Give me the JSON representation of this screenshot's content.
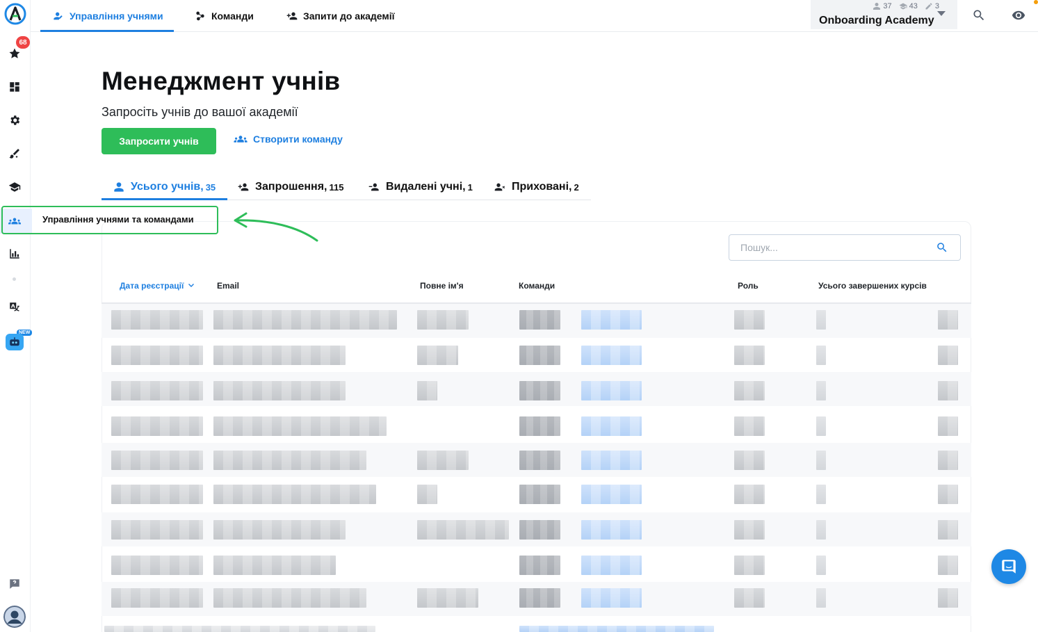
{
  "app": {
    "logo_icon": "academy-logo-icon",
    "accent": "#1e7fe0",
    "success": "#2ebd59",
    "badge_color": "#ef4444"
  },
  "sidebar": {
    "favorites_badge": "68",
    "new_label": "NEW",
    "items": [
      {
        "icon": "star-icon"
      },
      {
        "icon": "dashboard-icon"
      },
      {
        "icon": "gear-icon"
      },
      {
        "icon": "brush-icon"
      },
      {
        "icon": "graduation-cap-icon"
      },
      {
        "icon": "people-icon",
        "active": true
      },
      {
        "icon": "bar-chart-icon"
      },
      {
        "icon": "translate-icon"
      },
      {
        "icon": "robot-icon"
      },
      {
        "icon": "help-icon"
      },
      {
        "icon": "user-avatar-icon"
      }
    ]
  },
  "topnav": {
    "items": [
      {
        "label": "Управління учнями",
        "icon": "student-manage-icon",
        "active": true
      },
      {
        "label": "Команди",
        "icon": "teams-icon"
      },
      {
        "label": "Запити до академії",
        "icon": "add-person-icon"
      }
    ],
    "academy": {
      "name": "Onboarding Academy",
      "stats": [
        {
          "icon": "person-icon",
          "value": "37"
        },
        {
          "icon": "graduation-cap-icon",
          "value": "43"
        },
        {
          "icon": "pencil-icon",
          "value": "3"
        }
      ]
    }
  },
  "main": {
    "title": "Менеджмент учнів",
    "subtitle": "Запросіть учнів до вашої академії",
    "invite_button": "Запросити учнів",
    "create_team_button": "Створити команду",
    "tabs": [
      {
        "label": "Усього учнів,",
        "count": "35",
        "active": true
      },
      {
        "label": "Запрошення,",
        "count": "115"
      },
      {
        "label": "Видалені учні,",
        "count": "1"
      },
      {
        "label": "Приховані,",
        "count": "2"
      }
    ],
    "tooltip": "Управління учнями та командами",
    "search_placeholder": "Пошук...",
    "columns": [
      "Дата реєстрації",
      "Email",
      "Повне ім'я",
      "Команди",
      "Роль",
      "Усього завершених курсів"
    ]
  }
}
